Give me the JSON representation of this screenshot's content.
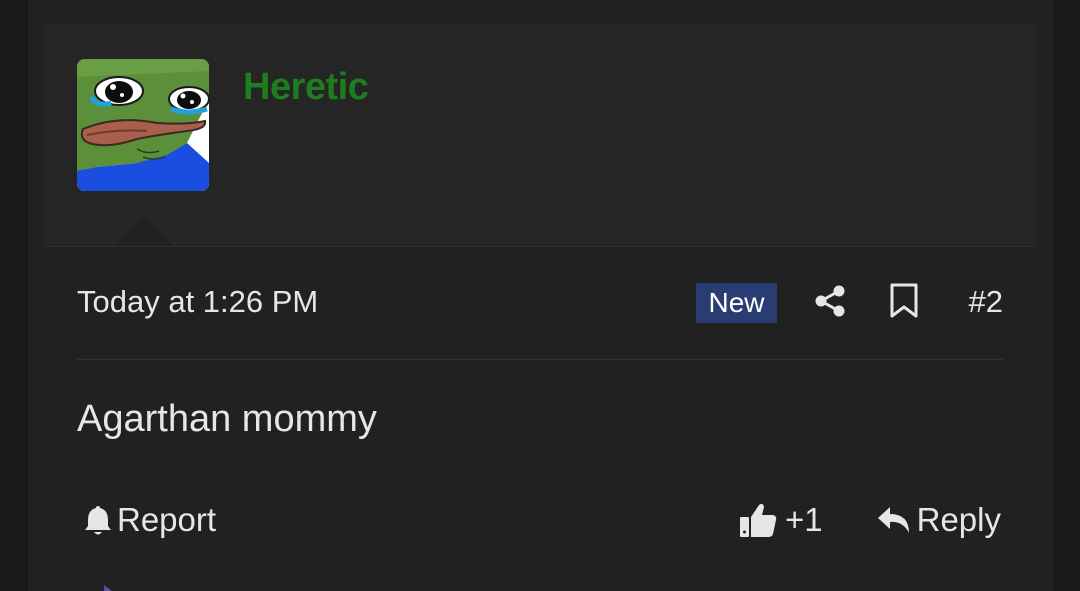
{
  "post": {
    "author": {
      "username": "Heretic",
      "username_color": "#1e7d1e",
      "avatar_icon": "crying-frog-avatar"
    },
    "timestamp": "Today at 1:26 PM",
    "badge": "New",
    "badge_color": "#2a3d72",
    "share_icon": "share-icon",
    "bookmark_icon": "bookmark-icon",
    "post_number": "#2",
    "message": "Agarthan mommy",
    "actions": {
      "report_label": "Report",
      "report_icon": "bell-icon",
      "like_count": "+1",
      "like_icon": "thumbs-up-icon",
      "reply_label": "Reply",
      "reply_icon": "reply-arrow-icon"
    }
  }
}
